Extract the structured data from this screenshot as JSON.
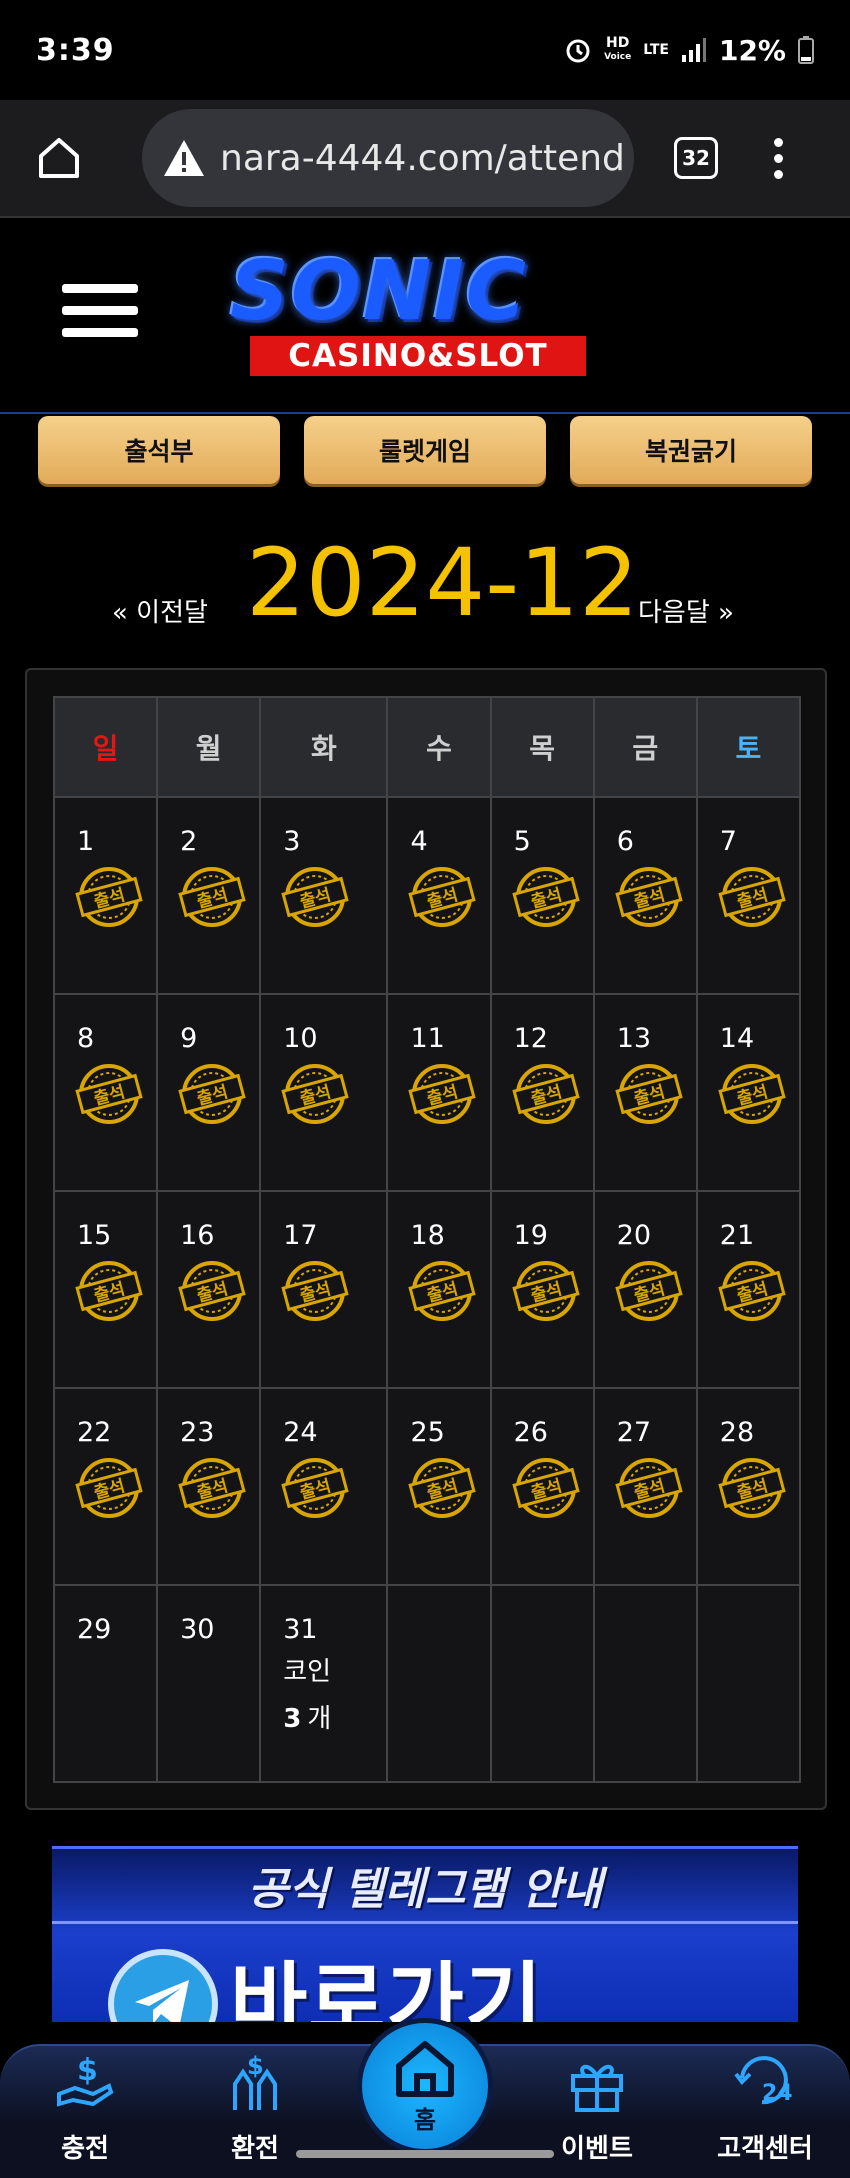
{
  "status_bar": {
    "time": "3:39",
    "network_hd": "HD",
    "network_voice": "Voice",
    "network_lte": "LTE",
    "battery": "12%"
  },
  "browser": {
    "url": "nara-4444.com/attend",
    "tab_count": "32"
  },
  "logo": {
    "brand": "SONIC",
    "tagline": "CASINO&SLOT"
  },
  "top_buttons": [
    "출석부",
    "룰렛게임",
    "복권긁기"
  ],
  "month_nav": {
    "prev": "« 이전달",
    "title": "2024-12",
    "next": "다음달 »"
  },
  "calendar": {
    "weekdays": [
      "일",
      "월",
      "화",
      "수",
      "목",
      "금",
      "토"
    ],
    "stamp_text": "출석",
    "weeks": [
      [
        {
          "day": "1",
          "attended": true
        },
        {
          "day": "2",
          "attended": true
        },
        {
          "day": "3",
          "attended": true
        },
        {
          "day": "4",
          "attended": true
        },
        {
          "day": "5",
          "attended": true
        },
        {
          "day": "6",
          "attended": true
        },
        {
          "day": "7",
          "attended": true
        }
      ],
      [
        {
          "day": "8",
          "attended": true
        },
        {
          "day": "9",
          "attended": true
        },
        {
          "day": "10",
          "attended": true
        },
        {
          "day": "11",
          "attended": true
        },
        {
          "day": "12",
          "attended": true
        },
        {
          "day": "13",
          "attended": true
        },
        {
          "day": "14",
          "attended": true
        }
      ],
      [
        {
          "day": "15",
          "attended": true
        },
        {
          "day": "16",
          "attended": true
        },
        {
          "day": "17",
          "attended": true
        },
        {
          "day": "18",
          "attended": true
        },
        {
          "day": "19",
          "attended": true
        },
        {
          "day": "20",
          "attended": true
        },
        {
          "day": "21",
          "attended": true
        }
      ],
      [
        {
          "day": "22",
          "attended": true
        },
        {
          "day": "23",
          "attended": true
        },
        {
          "day": "24",
          "attended": true
        },
        {
          "day": "25",
          "attended": true
        },
        {
          "day": "26",
          "attended": true
        },
        {
          "day": "27",
          "attended": true
        },
        {
          "day": "28",
          "attended": true
        }
      ],
      [
        {
          "day": "29",
          "attended": false
        },
        {
          "day": "30",
          "attended": false
        },
        {
          "day": "31",
          "attended": false,
          "coin_label": "코인",
          "coin_count": "3",
          "coin_unit": "개"
        },
        {
          "day": ""
        },
        {
          "day": ""
        },
        {
          "day": ""
        },
        {
          "day": ""
        }
      ]
    ]
  },
  "banner": {
    "title": "공식 텔레그램 안내",
    "cta": "바로가기 CLICK"
  },
  "bottom_nav": {
    "items": [
      {
        "label": "충전",
        "icon": "deposit-icon"
      },
      {
        "label": "환전",
        "icon": "withdraw-icon"
      },
      {
        "label": "홈",
        "icon": "home-icon"
      },
      {
        "label": "이벤트",
        "icon": "gift-icon"
      },
      {
        "label": "고객센터",
        "icon": "support-24-icon"
      }
    ]
  },
  "colors": {
    "accent_gold": "#f5c200",
    "button_gold": "#e8b766",
    "sunday_red": "#e51616",
    "saturday_blue": "#4ab3ff",
    "nav_blue": "#1cb8ff"
  }
}
